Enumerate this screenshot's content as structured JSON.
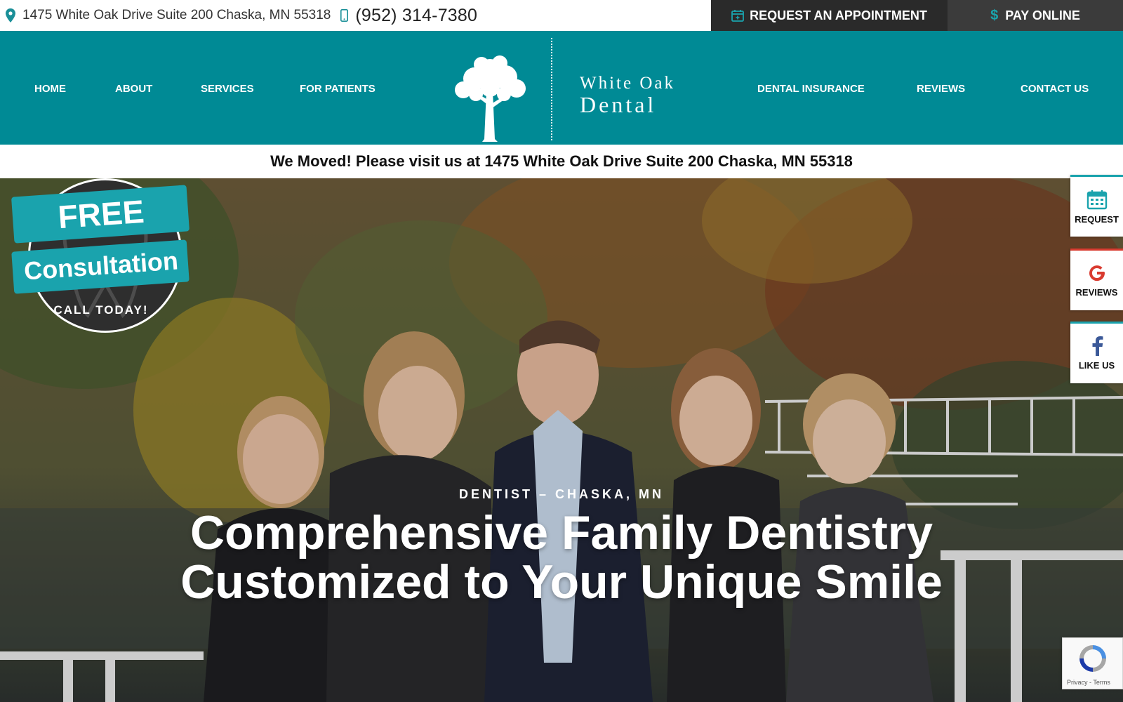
{
  "topbar": {
    "address": "1475 White Oak Drive Suite 200 Chaska, MN 55318",
    "phone": "(952) 314-7380",
    "appointment_label": "REQUEST AN APPOINTMENT",
    "pay_label": "PAY ONLINE"
  },
  "nav": {
    "items": [
      {
        "label": "HOME"
      },
      {
        "label": "ABOUT"
      },
      {
        "label": "SERVICES"
      },
      {
        "label": "FOR PATIENTS"
      },
      {
        "label": "DENTAL INSURANCE"
      },
      {
        "label": "REVIEWS"
      },
      {
        "label": "CONTACT US"
      }
    ],
    "logo": {
      "line1": "White Oak",
      "line2": "Dental"
    }
  },
  "announcement": "We Moved! Please visit us at 1475 White Oak Drive Suite 200 Chaska, MN 55318",
  "badge": {
    "free": "FREE",
    "consultation": "Consultation",
    "call": "CALL TODAY!"
  },
  "hero": {
    "eyebrow": "DENTIST – CHASKA, MN",
    "title_line1": "Comprehensive Family Dentistry",
    "title_line2": "Customized to Your Unique Smile"
  },
  "side_widgets": [
    {
      "label": "REQUEST",
      "icon": "calendar-icon"
    },
    {
      "label": "REVIEWS",
      "icon": "google-icon"
    },
    {
      "label": "LIKE US",
      "icon": "facebook-icon"
    }
  ],
  "recaptcha": {
    "privacy": "Privacy",
    "terms": "Terms"
  },
  "colors": {
    "teal": "#008a95",
    "accent": "#1aa3ad",
    "dark": "#2a2a2a"
  }
}
